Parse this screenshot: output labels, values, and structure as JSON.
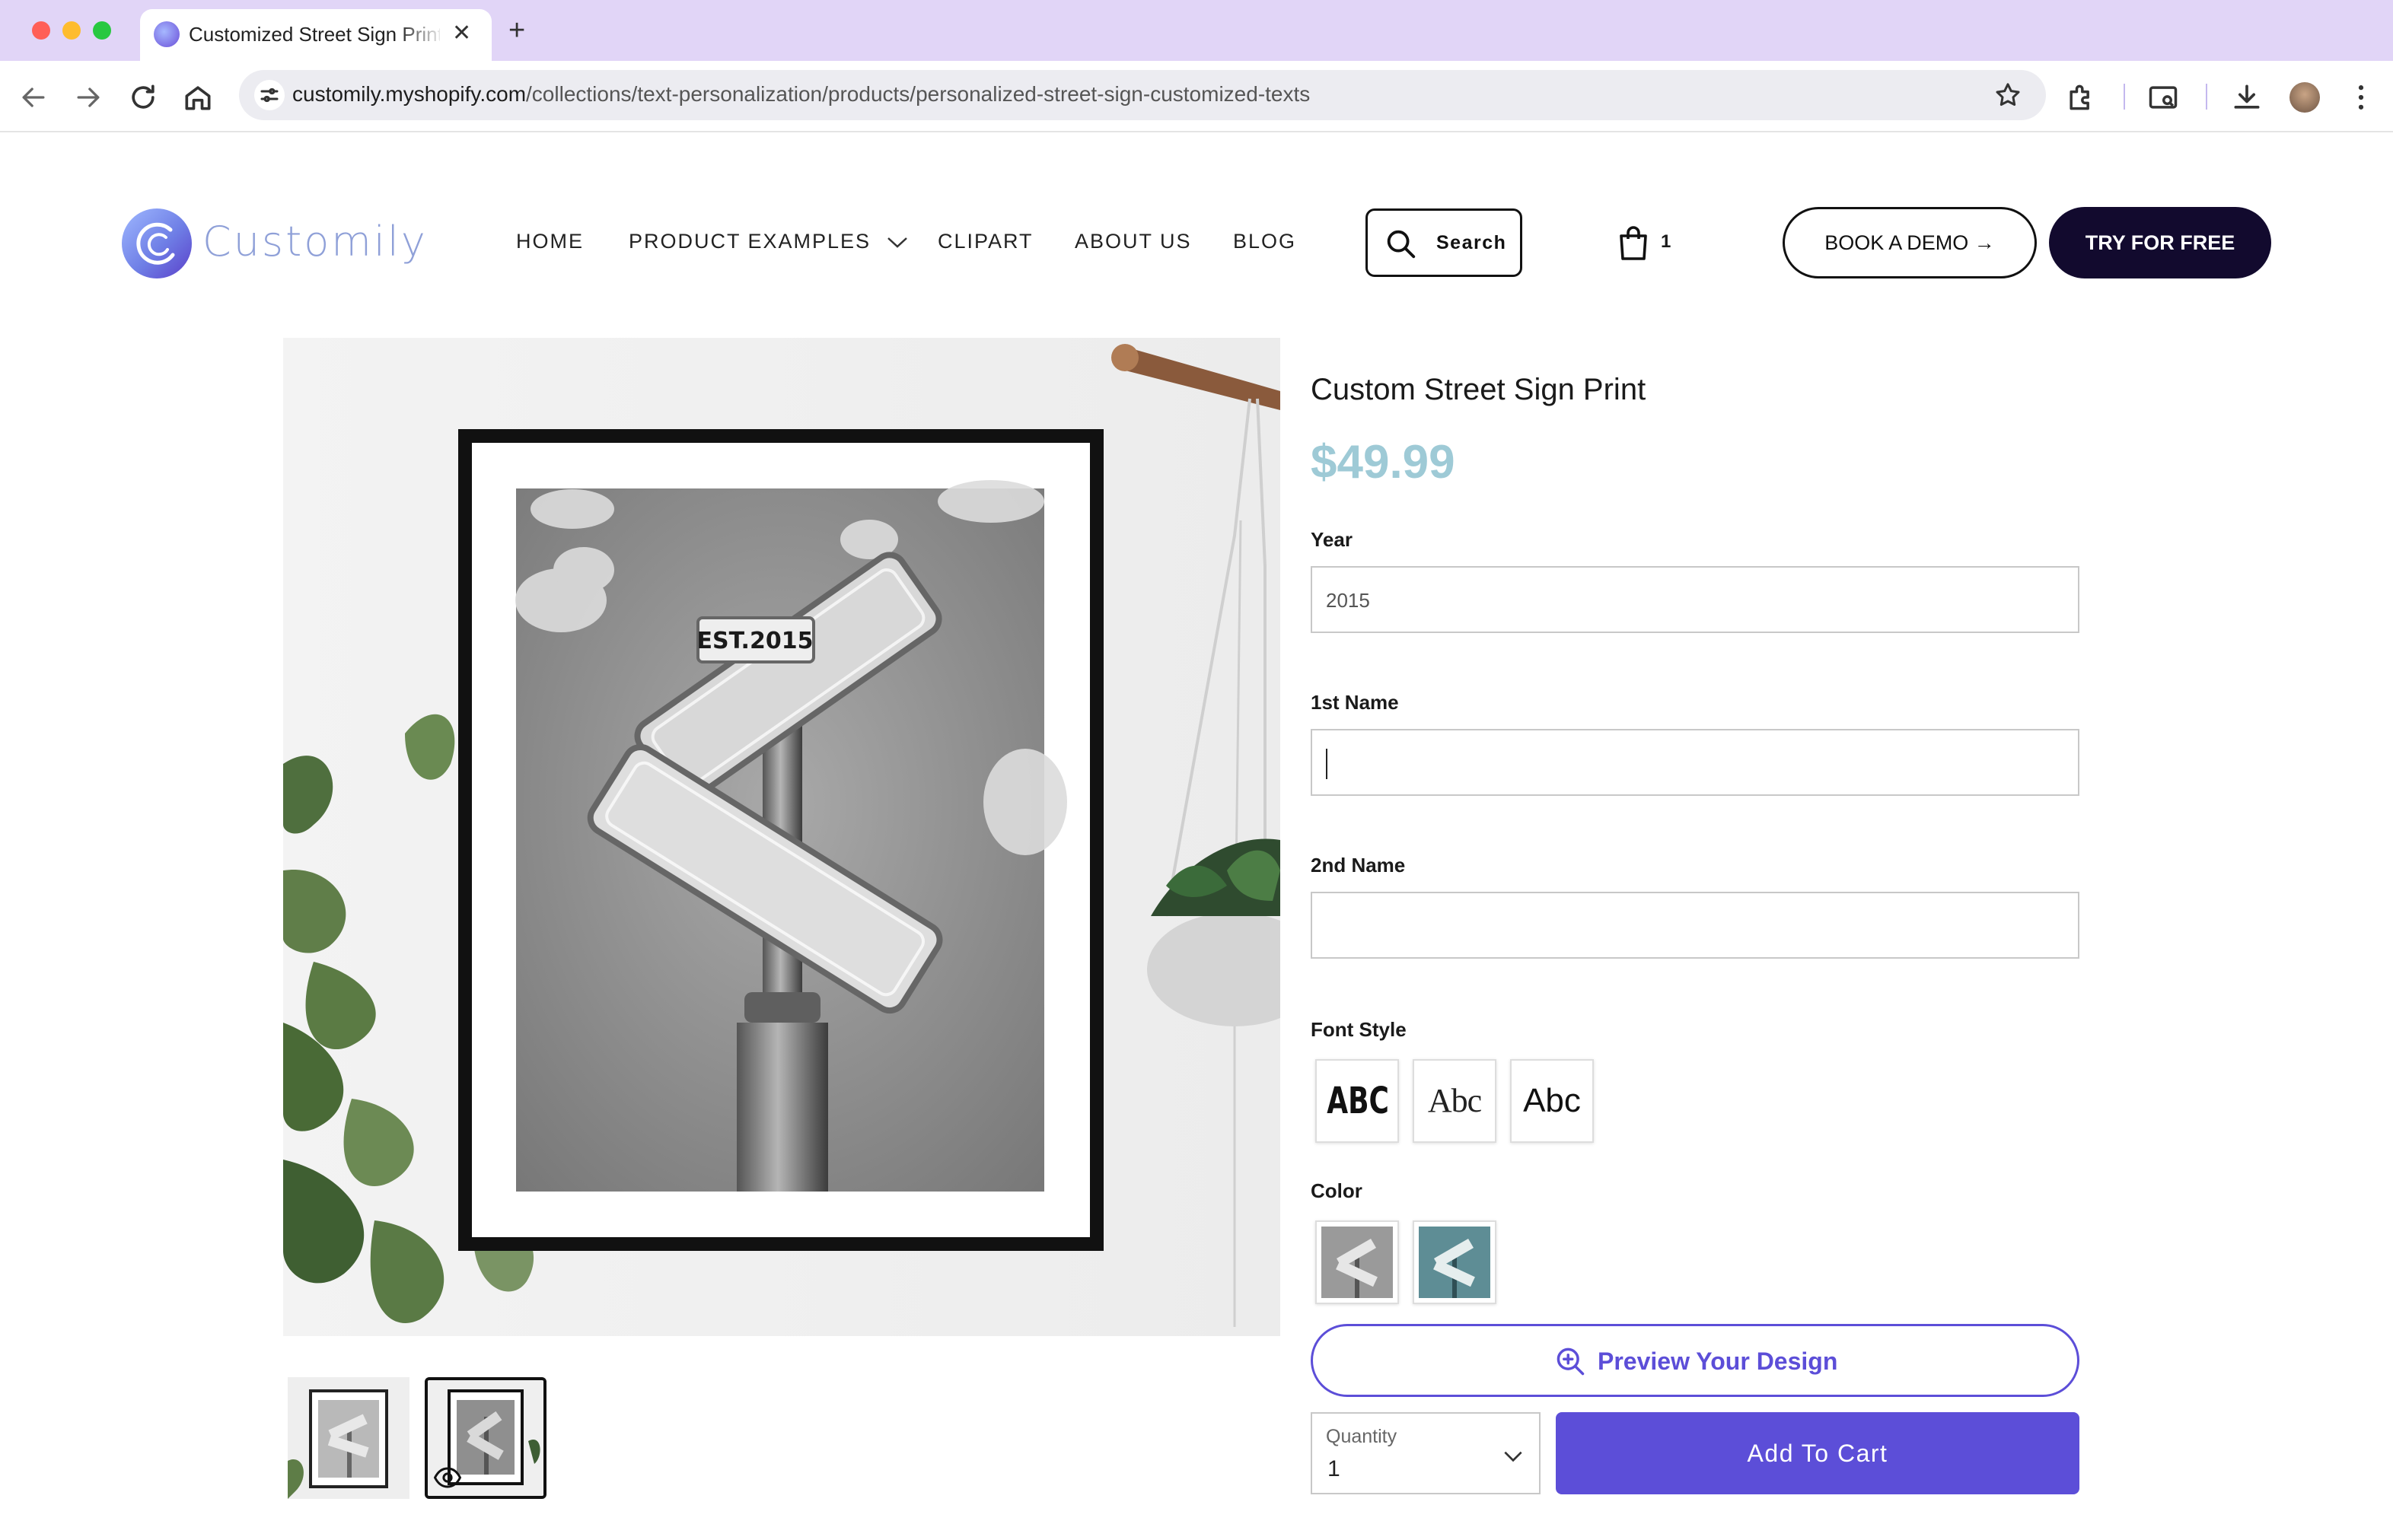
{
  "browser": {
    "tab_title": "Customized Street Sign Print",
    "url_host": "customily.myshopify.com",
    "url_path": "/collections/text-personalization/products/personalized-street-sign-customized-texts"
  },
  "site": {
    "brand": "Customily",
    "nav": [
      "HOME",
      "PRODUCT EXAMPLES",
      "CLIPART",
      "ABOUT US",
      "BLOG"
    ],
    "search_label": "Search",
    "cart_count": "1",
    "demo_label": "BOOK A DEMO →",
    "free_label": "TRY FOR FREE"
  },
  "product": {
    "title": "Custom Street Sign Print",
    "price": "$49.99",
    "image_sign_text": "EST.2015",
    "year_label": "Year",
    "year_value": "2015",
    "name1_label": "1st Name",
    "name1_value": "",
    "name2_label": "2nd Name",
    "name2_value": "",
    "font_label": "Font Style",
    "fonts": [
      "ABC",
      "Abc",
      "Abc"
    ],
    "color_label": "Color",
    "colors": [
      "#9a9a9a",
      "#5e8d95"
    ],
    "preview_label": "Preview Your Design",
    "qty_caption": "Quantity",
    "qty_value": "1",
    "add_to_cart_label": "Add To Cart"
  }
}
